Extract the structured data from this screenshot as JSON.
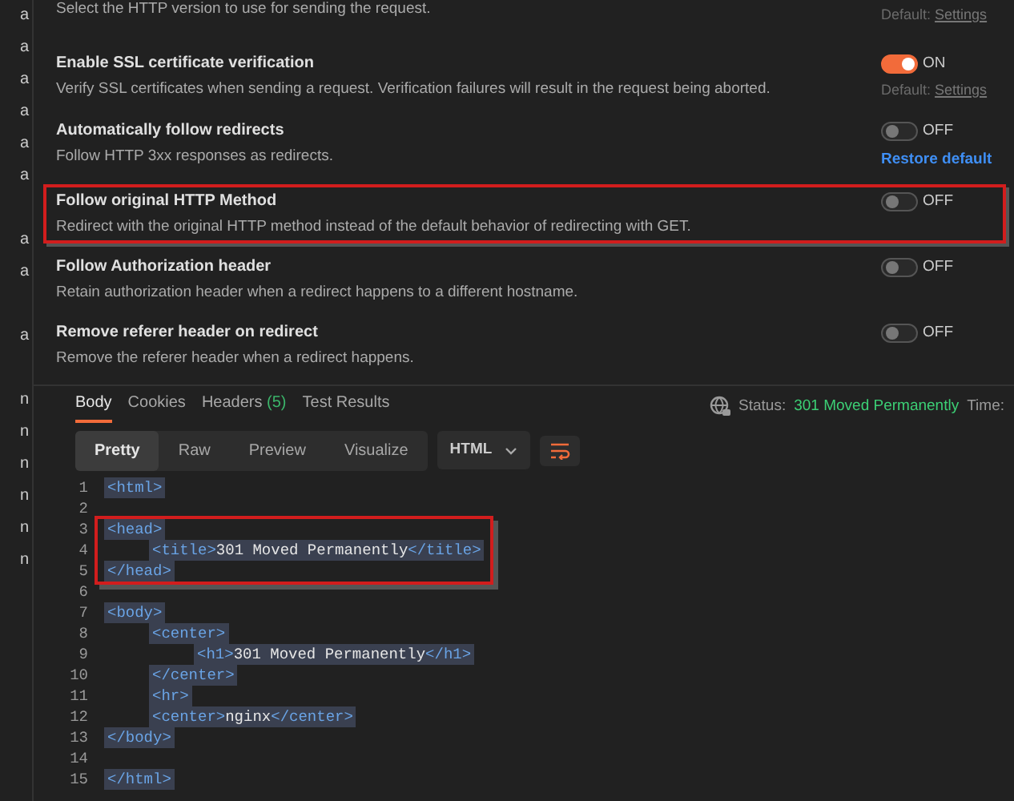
{
  "sidebar": {
    "items": [
      "a",
      "a",
      "a",
      "a",
      "a",
      "a",
      "a",
      "a",
      "a",
      "n",
      "n",
      "n",
      "n",
      "n",
      "n"
    ]
  },
  "settings": {
    "top_note": {
      "description": "Select the HTTP version to use for sending the request.",
      "default_label": "Default:",
      "default_link": "Settings"
    },
    "rows": [
      {
        "title": "Enable SSL certificate verification",
        "description": "Verify SSL certificates when sending a request. Verification failures will result in the request being aborted.",
        "on": true,
        "state_label": "ON",
        "highlighted": false,
        "footer": {
          "kind": "default",
          "label": "Default:",
          "link": "Settings"
        }
      },
      {
        "title": "Automatically follow redirects",
        "description": "Follow HTTP 3xx responses as redirects.",
        "on": false,
        "state_label": "OFF",
        "highlighted": false,
        "footer": {
          "kind": "restore",
          "link": "Restore default"
        }
      },
      {
        "title": "Follow original HTTP Method",
        "description": "Redirect with the original HTTP method instead of the default behavior of redirecting with GET.",
        "on": false,
        "state_label": "OFF",
        "highlighted": true
      },
      {
        "title": "Follow Authorization header",
        "description": "Retain authorization header when a redirect happens to a different hostname.",
        "on": false,
        "state_label": "OFF",
        "highlighted": false
      },
      {
        "title": "Remove referer header on redirect",
        "description": "Remove the referer header when a redirect happens.",
        "on": false,
        "state_label": "OFF",
        "highlighted": false
      }
    ]
  },
  "response": {
    "tabs": [
      {
        "label": "Body",
        "selected": true
      },
      {
        "label": "Cookies",
        "selected": false
      },
      {
        "label": "Headers",
        "count": "(5)",
        "selected": false
      },
      {
        "label": "Test Results",
        "selected": false
      }
    ],
    "status_label": "Status:",
    "status_value": "301 Moved Permanently",
    "time_label": "Time:",
    "view_modes": [
      {
        "label": "Pretty",
        "selected": true
      },
      {
        "label": "Raw",
        "selected": false
      },
      {
        "label": "Preview",
        "selected": false
      },
      {
        "label": "Visualize",
        "selected": false
      }
    ],
    "format": "HTML",
    "code_blocks": [
      {
        "highlighted": false,
        "lines": [
          {
            "number": "1",
            "segments": [
              {
                "kind": "tag",
                "text": "<html>"
              }
            ]
          },
          {
            "number": "2"
          }
        ]
      },
      {
        "highlighted": true,
        "lines": [
          {
            "number": "3",
            "segments": [
              {
                "kind": "tag",
                "text": "<head>"
              }
            ],
            "children": [
              {
                "number": "4",
                "segments": [
                  {
                    "kind": "tag",
                    "text": "<title>"
                  },
                  {
                    "kind": "text",
                    "text": "301 Moved Permanently"
                  },
                  {
                    "kind": "tag",
                    "text": "</title>"
                  }
                ]
              }
            ]
          },
          {
            "number": "5",
            "segments": [
              {
                "kind": "tag",
                "text": "</head>"
              }
            ]
          }
        ]
      },
      {
        "highlighted": false,
        "lines": [
          {
            "number": "6"
          },
          {
            "number": "7",
            "segments": [
              {
                "kind": "tag",
                "text": "<body>"
              }
            ],
            "children": [
              {
                "number": "8",
                "segments": [
                  {
                    "kind": "tag",
                    "text": "<center>"
                  }
                ],
                "children": [
                  {
                    "number": "9",
                    "segments": [
                      {
                        "kind": "tag",
                        "text": "<h1>"
                      },
                      {
                        "kind": "text",
                        "text": "301 Moved Permanently"
                      },
                      {
                        "kind": "tag",
                        "text": "</h1>"
                      }
                    ]
                  }
                ]
              },
              {
                "number": "10",
                "segments": [
                  {
                    "kind": "tag",
                    "text": "</center>"
                  }
                ]
              },
              {
                "number": "11",
                "segments": [
                  {
                    "kind": "tag",
                    "text": "<hr>"
                  }
                ]
              },
              {
                "number": "12",
                "segments": [
                  {
                    "kind": "tag",
                    "text": "<center>"
                  },
                  {
                    "kind": "text",
                    "text": "nginx"
                  },
                  {
                    "kind": "tag",
                    "text": "</center>"
                  }
                ]
              }
            ]
          },
          {
            "number": "13",
            "segments": [
              {
                "kind": "tag",
                "text": "</body>"
              }
            ]
          },
          {
            "number": "14"
          },
          {
            "number": "15",
            "segments": [
              {
                "kind": "tag",
                "text": "</html>"
              }
            ]
          }
        ]
      }
    ]
  }
}
